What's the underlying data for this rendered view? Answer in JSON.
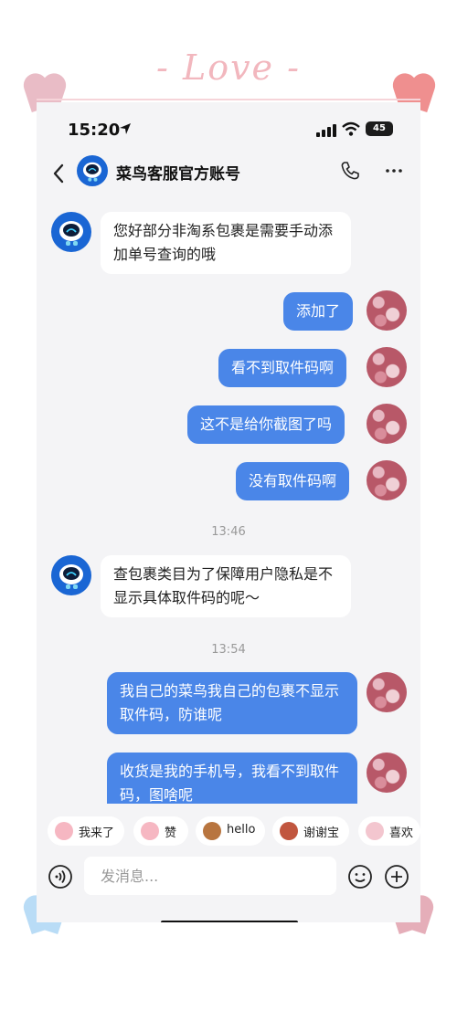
{
  "decor": {
    "love_text": "- Love -"
  },
  "status_bar": {
    "time": "15:20",
    "battery": "45"
  },
  "nav": {
    "title": "菜鸟客服官方账号"
  },
  "chat": {
    "messages": [
      {
        "from": "bot",
        "text": "您好部分非淘系包裹是需要手动添加单号查询的哦"
      },
      {
        "from": "user",
        "text": "添加了"
      },
      {
        "from": "user",
        "text": "看不到取件码啊"
      },
      {
        "from": "user",
        "text": "这不是给你截图了吗"
      },
      {
        "from": "user",
        "text": "没有取件码啊"
      },
      {
        "from": "bot",
        "text": "查包裹类目为了保障用户隐私是不显示具体取件码的呢～"
      },
      {
        "from": "user",
        "text": "我自己的菜鸟我自己的包裹不显示取件码，防谁呢"
      },
      {
        "from": "user",
        "text": "收货是我的手机号，我看不到取件码，图啥呢"
      }
    ],
    "timestamps": [
      "13:46",
      "13:54"
    ]
  },
  "quick_replies": [
    "我来了",
    "赞",
    "hello",
    "谢谢宝",
    "喜欢"
  ],
  "input": {
    "placeholder": "发消息..."
  },
  "colors": {
    "out_bubble": "#4a86e8",
    "bot_avatar": "#1a66d4",
    "background": "#f4f4f6"
  },
  "icons": [
    "location-arrow-icon",
    "signal-icon",
    "wifi-icon",
    "battery-icon",
    "back-arrow-icon",
    "phone-icon",
    "more-icon",
    "voice-icon",
    "emoji-icon",
    "plus-icon"
  ]
}
